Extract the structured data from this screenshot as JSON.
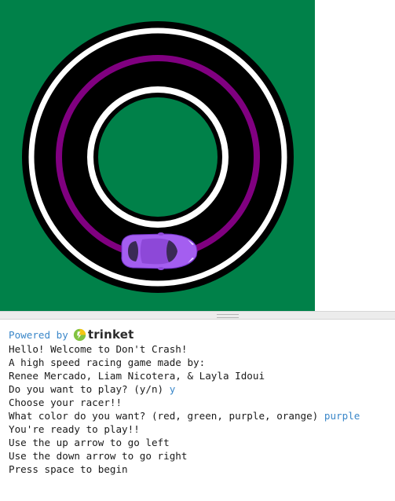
{
  "colors": {
    "grass": "#008149",
    "track": "#000000",
    "lane_white": "#ffffff",
    "lane_purple": "#800080",
    "car_body": "#a45ef0",
    "car_dark": "#3a2a55",
    "link_blue": "#3a87c9",
    "logo_green": "#82c341",
    "logo_yellow": "#f5c614"
  },
  "game": {
    "player_color": "purple",
    "track_shape": "circle"
  },
  "console": {
    "powered_by": "Powered by",
    "brand": "trinket",
    "lines": [
      {
        "text": "Hello! Welcome to Don't Crash!",
        "answer": ""
      },
      {
        "text": "A high speed racing game made by:",
        "answer": ""
      },
      {
        "text": "Renee Mercado, Liam Nicotera, & Layla Idoui",
        "answer": ""
      },
      {
        "text": "Do you want to play? (y/n) ",
        "answer": "y"
      },
      {
        "text": "Choose your racer!!",
        "answer": ""
      },
      {
        "text": "What color do you want? (red, green, purple, orange) ",
        "answer": "purple"
      },
      {
        "text": "You're ready to play!!",
        "answer": ""
      },
      {
        "text": "Use the up arrow to go left",
        "answer": ""
      },
      {
        "text": "Use the down arrow to go right",
        "answer": ""
      },
      {
        "text": "Press space to begin",
        "answer": ""
      }
    ]
  }
}
